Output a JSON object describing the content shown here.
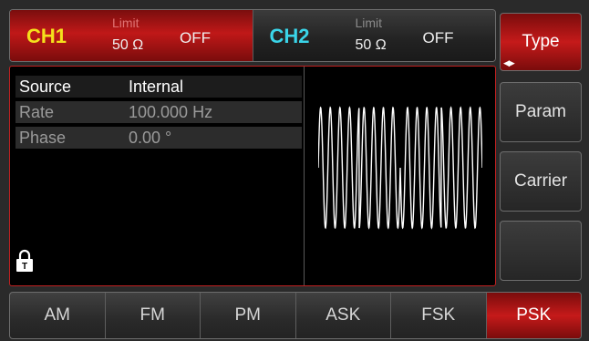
{
  "channels": [
    {
      "name": "CH1",
      "limit_label": "Limit",
      "impedance": "50 Ω",
      "state": "OFF"
    },
    {
      "name": "CH2",
      "limit_label": "Limit",
      "impedance": "50 Ω",
      "state": "OFF"
    }
  ],
  "softkeys": {
    "type": "Type",
    "param": "Param",
    "carrier": "Carrier",
    "empty": ""
  },
  "params": [
    {
      "name": "Source",
      "value": "Internal"
    },
    {
      "name": "Rate",
      "value": "100.000 Hz"
    },
    {
      "name": "Phase",
      "value": "0.00 °"
    }
  ],
  "tabs": [
    "AM",
    "FM",
    "PM",
    "ASK",
    "FSK",
    "PSK"
  ],
  "active_tab": "PSK",
  "colors": {
    "ch1_name": "#f4e01c",
    "ch2_name": "#3ad4e8",
    "active_red": "#c51a1a",
    "panel_border": "#c02020"
  }
}
